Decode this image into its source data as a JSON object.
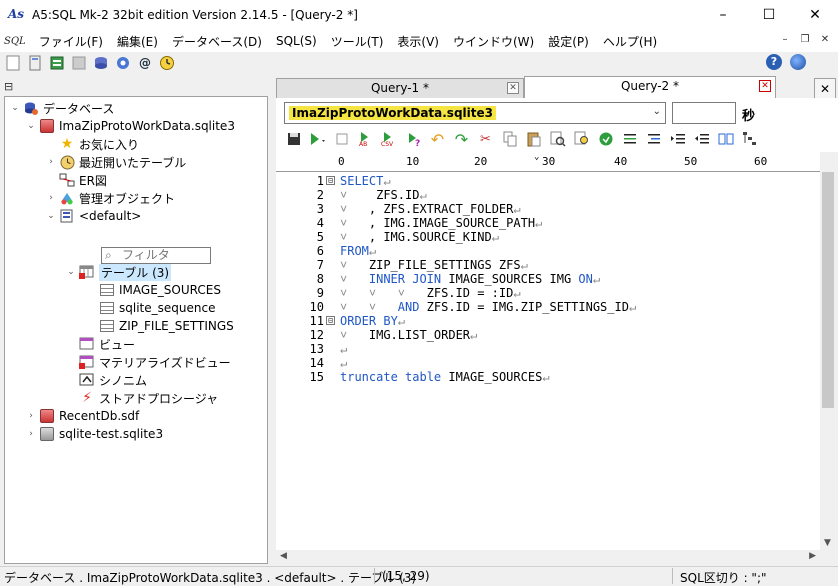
{
  "window": {
    "title": "A5:SQL Mk-2 32bit edition Version 2.14.5 - [Query-2 *]",
    "app_icon": "As",
    "minimize_icon": "–",
    "maximize_icon": "☐",
    "close_icon": "✕"
  },
  "menu": {
    "logo": "SQL",
    "items": [
      "ファイル(F)",
      "編集(E)",
      "データベース(D)",
      "SQL(S)",
      "ツール(T)",
      "表示(V)",
      "ウインドウ(W)",
      "設定(P)",
      "ヘルプ(H)"
    ],
    "mdi_minimize": "–",
    "mdi_restore": "❐",
    "mdi_close": "✕"
  },
  "toolbar": {
    "help_icon": "?",
    "close_panel": "✕"
  },
  "tree": {
    "root": "データベース",
    "db1": "ImaZipProtoWorkData.sqlite3",
    "favorites": "お気に入り",
    "recent_tables": "最近開いたテーブル",
    "er": "ER図",
    "admin_objects": "管理オブジェクト",
    "default_schema": "<default>",
    "filter_placeholder": "フィルタ",
    "tables": "テーブル (3)",
    "table_items": [
      "IMAGE_SOURCES",
      "sqlite_sequence",
      "ZIP_FILE_SETTINGS"
    ],
    "views": "ビュー",
    "mviews": "マテリアライズドビュー",
    "synonyms": "シノニム",
    "procedures": "ストアドプロシージャ",
    "db2": "RecentDb.sdf",
    "db3": "sqlite-test.sqlite3"
  },
  "tabs": [
    {
      "label": "Query-1 *",
      "active": false
    },
    {
      "label": "Query-2 *",
      "active": true
    }
  ],
  "connection": {
    "selected": "ImaZipProtoWorkData.sqlite3",
    "seconds_value": "",
    "seconds_label": "秒"
  },
  "ruler": {
    "ticks": [
      "0",
      "10",
      "20",
      "30",
      "40",
      "50",
      "60"
    ]
  },
  "editor": {
    "line_numbers": [
      "1",
      "2",
      "3",
      "4",
      "5",
      "6",
      "7",
      "8",
      "9",
      "10",
      "11",
      "12",
      "13",
      "14",
      "15"
    ],
    "lines": [
      [
        {
          "t": "SELECT",
          "k": true
        },
        {
          "t": "↵",
          "r": true
        }
      ],
      [
        {
          "t": "˅    ",
          "r": true
        },
        {
          "t": "ZFS.ID"
        },
        {
          "t": "↵",
          "r": true
        }
      ],
      [
        {
          "t": "˅   ",
          "r": true
        },
        {
          "t": ", ZFS.EXTRACT_FOLDER"
        },
        {
          "t": "↵",
          "r": true
        }
      ],
      [
        {
          "t": "˅   ",
          "r": true
        },
        {
          "t": ", IMG.IMAGE_SOURCE_PATH"
        },
        {
          "t": "↵",
          "r": true
        }
      ],
      [
        {
          "t": "˅   ",
          "r": true
        },
        {
          "t": ", IMG.SOURCE_KIND"
        },
        {
          "t": "↵",
          "r": true
        }
      ],
      [
        {
          "t": "FROM",
          "k": true
        },
        {
          "t": "↵",
          "r": true
        }
      ],
      [
        {
          "t": "˅   ",
          "r": true
        },
        {
          "t": "ZIP_FILE_SETTINGS ZFS"
        },
        {
          "t": "↵",
          "r": true
        }
      ],
      [
        {
          "t": "˅   ",
          "r": true
        },
        {
          "t": "INNER JOIN",
          "k": true
        },
        {
          "t": " IMAGE_SOURCES IMG "
        },
        {
          "t": "ON",
          "k": true
        },
        {
          "t": "↵",
          "r": true
        }
      ],
      [
        {
          "t": "˅   ˅   ˅   ",
          "r": true
        },
        {
          "t": "ZFS.ID = :ID"
        },
        {
          "t": "↵",
          "r": true
        }
      ],
      [
        {
          "t": "˅   ˅   ",
          "r": true
        },
        {
          "t": "AND",
          "k": true
        },
        {
          "t": " ZFS.ID = IMG.ZIP_SETTINGS_ID"
        },
        {
          "t": "↵",
          "r": true
        }
      ],
      [
        {
          "t": "ORDER BY",
          "k": true
        },
        {
          "t": "↵",
          "r": true
        }
      ],
      [
        {
          "t": "˅   ",
          "r": true
        },
        {
          "t": "IMG.LIST_ORDER"
        },
        {
          "t": "↵",
          "r": true
        }
      ],
      [
        {
          "t": "↵",
          "r": true
        }
      ],
      [
        {
          "t": "↵",
          "r": true
        }
      ],
      [
        {
          "t": "truncate",
          "k": true
        },
        {
          "t": " "
        },
        {
          "t": "table",
          "k": true
        },
        {
          "t": " IMAGE_SOURCES"
        },
        {
          "t": "↵",
          "r": true
        }
      ]
    ],
    "fold_markers": [
      "⊟",
      "⊟"
    ]
  },
  "status": {
    "path": "データベース . ImaZipProtoWorkData.sqlite3 . <default> . テーブル (3)",
    "cursor": "(15, 29)",
    "sql_delimiter": "SQL区切り : \";\""
  },
  "colors": {
    "keyword": "#1f57c6",
    "connection_highlight": "#f5e542",
    "selection": "#cce8ff"
  }
}
